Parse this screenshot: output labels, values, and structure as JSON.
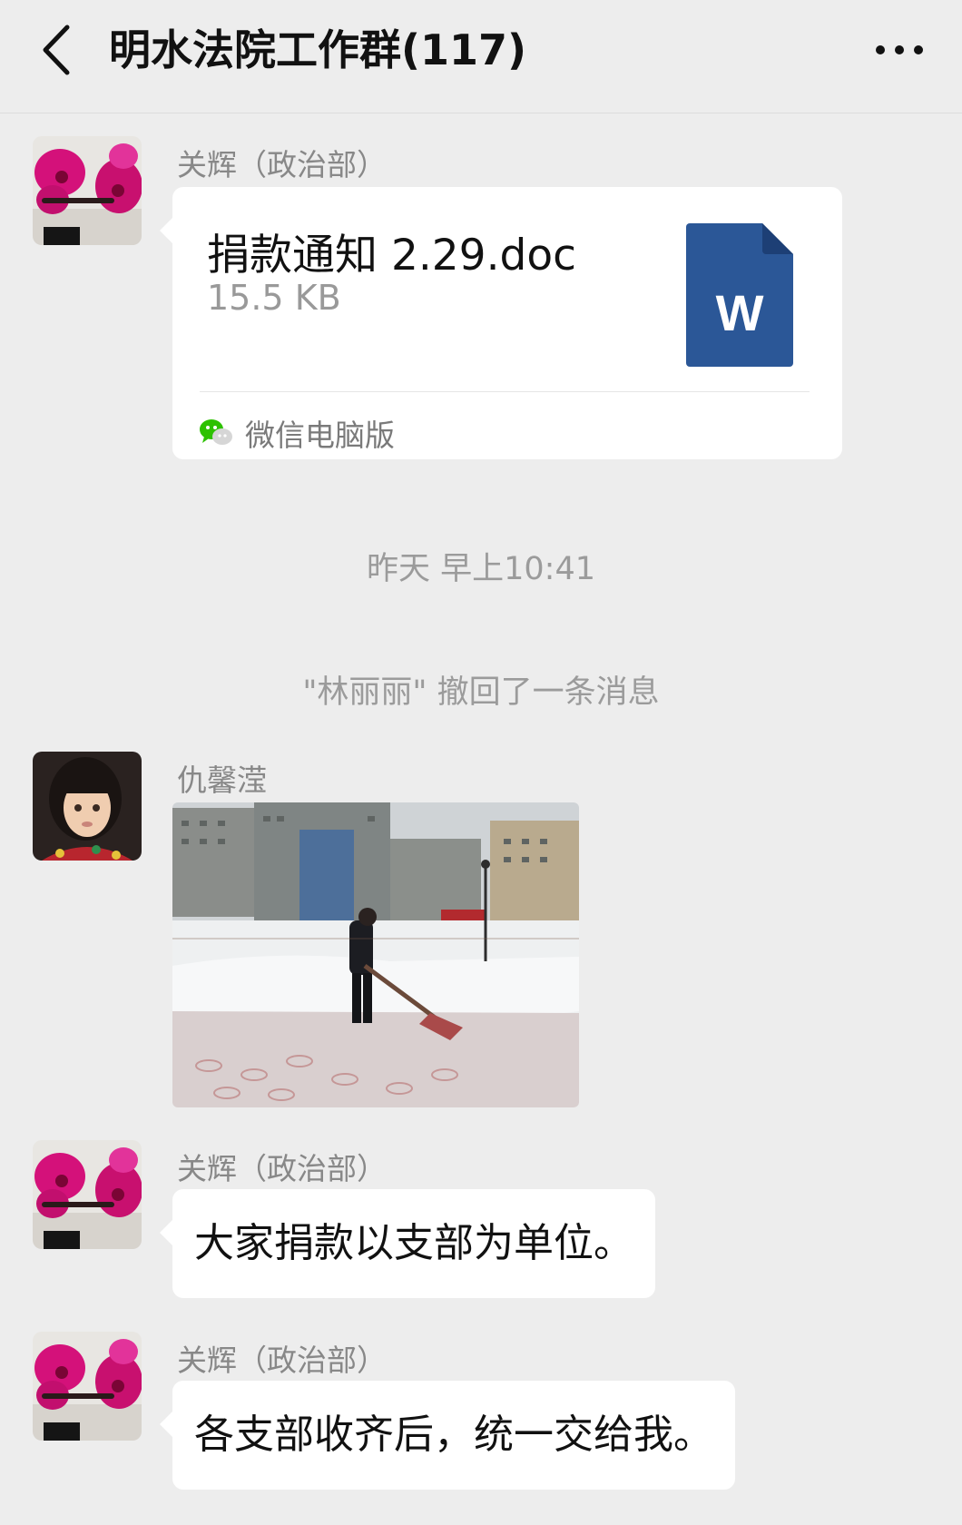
{
  "header": {
    "title": "明水法院工作群(117)",
    "back_icon": "chevron-left-icon",
    "more_icon": "more-dots-icon"
  },
  "messages": [
    {
      "type": "file",
      "sender": "关辉（政治部）",
      "file_name": "捐款通知 2.29.doc",
      "file_size": "15.5 KB",
      "file_badge": "W",
      "source_label": "微信电脑版",
      "file_icon": "word-doc-icon"
    },
    {
      "type": "system",
      "text": "昨天 早上10:41"
    },
    {
      "type": "system",
      "text": "\"林丽丽\" 撤回了一条消息"
    },
    {
      "type": "image",
      "sender": "仇馨滢"
    },
    {
      "type": "text",
      "sender": "关辉（政治部）",
      "text": "大家捐款以支部为单位。"
    },
    {
      "type": "text",
      "sender": "关辉（政治部）",
      "text": "各支部收齐后，统一交给我。"
    }
  ],
  "colors": {
    "background": "#ededed",
    "bubble": "#ffffff",
    "word_blue": "#2b5797",
    "wechat_green": "#2dc100",
    "muted_text": "#9b9b9b"
  }
}
